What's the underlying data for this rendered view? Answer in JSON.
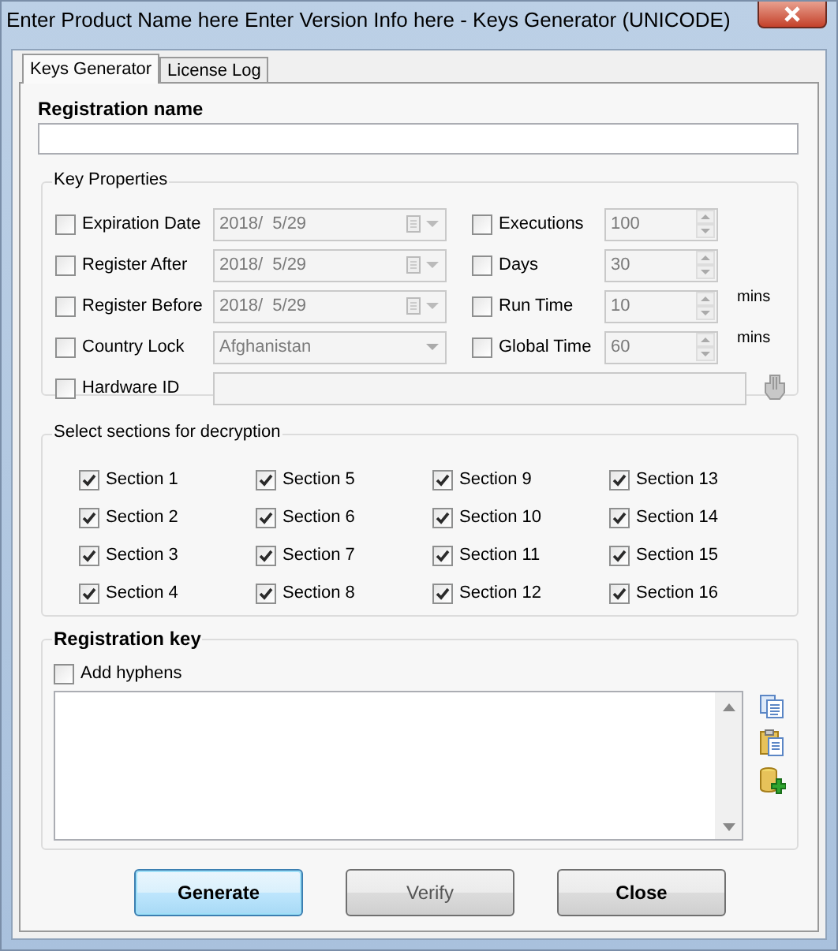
{
  "window": {
    "title": "Enter Product Name here Enter Version Info here - Keys Generator (UNICODE)"
  },
  "tabs": [
    {
      "label": "Keys Generator",
      "selected": true
    },
    {
      "label": "License Log",
      "selected": false
    }
  ],
  "registration_name": {
    "label": "Registration name"
  },
  "key_properties": {
    "title": "Key Properties",
    "rows": [
      {
        "left": {
          "label": "Expiration Date",
          "checked": false,
          "kind": "date",
          "value": "2018/  5/29"
        },
        "right": {
          "label": "Executions",
          "checked": false,
          "value": "100"
        }
      },
      {
        "left": {
          "label": "Register After",
          "checked": false,
          "kind": "date",
          "value": "2018/  5/29"
        },
        "right": {
          "label": "Days",
          "checked": false,
          "value": "30"
        }
      },
      {
        "left": {
          "label": "Register Before",
          "checked": false,
          "kind": "date",
          "value": "2018/  5/29"
        },
        "right": {
          "label": "Run Time",
          "checked": false,
          "value": "10",
          "unit": "mins"
        }
      },
      {
        "left": {
          "label": "Country Lock",
          "checked": false,
          "kind": "combo",
          "value": "Afghanistan"
        },
        "right": {
          "label": "Global Time",
          "checked": false,
          "value": "60",
          "unit": "mins"
        }
      }
    ],
    "hardware_id": {
      "label": "Hardware ID",
      "checked": false
    }
  },
  "sections": {
    "title": "Select sections for decryption",
    "items": [
      {
        "label": "Section 1",
        "checked": true
      },
      {
        "label": "Section 5",
        "checked": true
      },
      {
        "label": "Section 9",
        "checked": true
      },
      {
        "label": "Section 13",
        "checked": true
      },
      {
        "label": "Section 2",
        "checked": true
      },
      {
        "label": "Section 6",
        "checked": true
      },
      {
        "label": "Section 10",
        "checked": true
      },
      {
        "label": "Section 14",
        "checked": true
      },
      {
        "label": "Section 3",
        "checked": true
      },
      {
        "label": "Section 7",
        "checked": true
      },
      {
        "label": "Section 11",
        "checked": true
      },
      {
        "label": "Section 15",
        "checked": true
      },
      {
        "label": "Section 4",
        "checked": true
      },
      {
        "label": "Section 8",
        "checked": true
      },
      {
        "label": "Section 12",
        "checked": true
      },
      {
        "label": "Section 16",
        "checked": true
      }
    ]
  },
  "registration_key": {
    "title": "Registration key",
    "add_hyphens": {
      "label": "Add hyphens",
      "checked": false
    }
  },
  "buttons": [
    {
      "label": "Generate",
      "kind": "default",
      "disabled": false
    },
    {
      "label": "Verify",
      "kind": "normal",
      "disabled": true
    },
    {
      "label": "Close",
      "kind": "normal",
      "disabled": false
    }
  ]
}
